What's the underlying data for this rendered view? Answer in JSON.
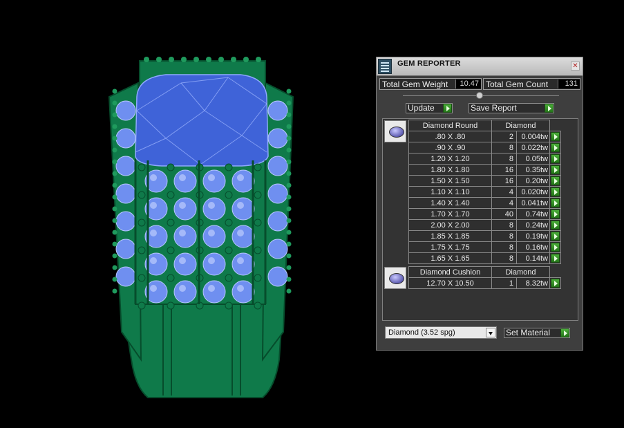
{
  "panel": {
    "title": "GEM REPORTER",
    "close_glyph": "✕",
    "total_gem_weight_label": "Total Gem Weight",
    "total_gem_weight_value": "10.47",
    "total_gem_count_label": "Total Gem Count",
    "total_gem_count_value": "131",
    "update_label": "Update",
    "save_report_label": "Save Report",
    "set_material_label": "Set Material",
    "material_selected": "Diamond      (3.52 spg)"
  },
  "groups": [
    {
      "shape": "Diamond Round",
      "material": "Diamond",
      "icon": "round-gem-icon",
      "rows": [
        {
          "size": ".80 X .80",
          "count": "2",
          "weight": "0.004tw"
        },
        {
          "size": ".90 X .90",
          "count": "8",
          "weight": "0.022tw"
        },
        {
          "size": "1.20 X 1.20",
          "count": "8",
          "weight": "0.05tw"
        },
        {
          "size": "1.80 X 1.80",
          "count": "16",
          "weight": "0.35tw"
        },
        {
          "size": "1.50 X 1.50",
          "count": "16",
          "weight": "0.20tw"
        },
        {
          "size": "1.10 X 1.10",
          "count": "4",
          "weight": "0.020tw"
        },
        {
          "size": "1.40 X 1.40",
          "count": "4",
          "weight": "0.041tw"
        },
        {
          "size": "1.70 X 1.70",
          "count": "40",
          "weight": "0.74tw"
        },
        {
          "size": "2.00 X 2.00",
          "count": "8",
          "weight": "0.24tw"
        },
        {
          "size": "1.85 X 1.85",
          "count": "8",
          "weight": "0.19tw"
        },
        {
          "size": "1.75 X 1.75",
          "count": "8",
          "weight": "0.16tw"
        },
        {
          "size": "1.65 X 1.65",
          "count": "8",
          "weight": "0.14tw"
        }
      ]
    },
    {
      "shape": "Diamond Cushion",
      "material": "Diamond",
      "icon": "cushion-gem-icon",
      "rows": [
        {
          "size": "12.70 X 10.50",
          "count": "1",
          "weight": "8.32tw"
        }
      ]
    }
  ],
  "colors": {
    "metal": "#0f7a4a",
    "metal_dark": "#064d2c",
    "gem": "#6f8ff0",
    "center_stone": "#3f63d8",
    "background": "#000000",
    "panel": "#3e3e3e"
  }
}
